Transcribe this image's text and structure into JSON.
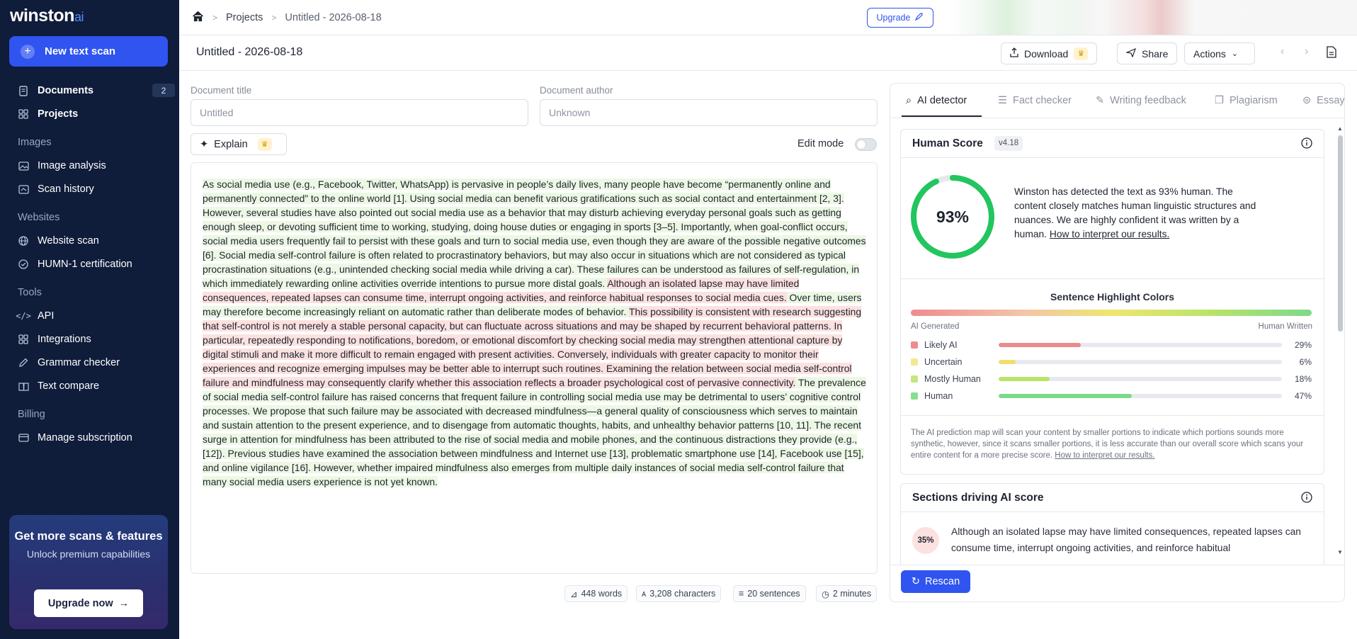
{
  "app": {
    "logo_main": "winston",
    "logo_suffix": "ai"
  },
  "sidebar": {
    "new_scan": "New text scan",
    "documents": {
      "label": "Documents",
      "count": "2"
    },
    "projects": "Projects",
    "images_title": "Images",
    "image_analysis": "Image analysis",
    "scan_history": "Scan history",
    "websites_title": "Websites",
    "website_scan": "Website scan",
    "humn_cert": "HUMN-1 certification",
    "tools_title": "Tools",
    "api": "API",
    "integrations": "Integrations",
    "grammar_checker": "Grammar checker",
    "text_compare": "Text compare",
    "billing_title": "Billing",
    "manage_subscription": "Manage subscription",
    "promo": {
      "title": "Get more scans & features",
      "subtitle": "Unlock premium capabilities",
      "button": "Upgrade now"
    }
  },
  "topbar": {
    "breadcrumb_projects": "Projects",
    "breadcrumb_current": "Untitled - 2026-08-18",
    "upgrade": "Upgrade"
  },
  "toolbar": {
    "doc_title": "Untitled - 2026-08-18",
    "download": "Download",
    "share": "Share",
    "actions": "Actions"
  },
  "form": {
    "title_label": "Document title",
    "title_placeholder": "Untitled",
    "author_label": "Document author",
    "author_placeholder": "Unknown",
    "explain": "Explain",
    "edit_mode": "Edit mode"
  },
  "document": {
    "segments": [
      {
        "type": "human",
        "text": "As social media use (e.g., Facebook, Twitter, WhatsApp) is pervasive in people’s daily lives, many people have become “permanently online and permanently connected” to the online world [1]. Using social media can benefit various gratifications such as social contact and entertainment [2, 3]. However, several studies have also pointed out social media use as a behavior that may disturb achieving everyday personal goals such as getting enough sleep, or devoting sufficient time to working, studying, doing house duties or engaging in sports [3–5]. Importantly, when goal-conflict occurs, social media users frequently fail to persist with these goals and turn to social media use, even though they are aware of the possible negative outcomes [6]. Social media self-control failure is often related to procrastinatory behaviors, but may also occur in situations which are not considered as typical procrastination situations (e.g., unintended checking social media while driving a car). These failures can be understood as failures of self-regulation, in which immediately rewarding online activities override intentions to pursue more distal goals. "
      },
      {
        "type": "ai",
        "text": "Although an isolated lapse may have limited consequences, repeated lapses can consume time, interrupt ongoing activities, and reinforce habitual responses to social media cues."
      },
      {
        "type": "human",
        "text": " Over time, users may therefore become increasingly reliant on automatic rather than deliberate modes of behavior. "
      },
      {
        "type": "ai",
        "text": "This possibility is consistent with research suggesting that self-control is not merely a stable personal capacity, but can fluctuate across situations and may be shaped by recurrent behavioral patterns. In particular, repeatedly responding to notifications, boredom, or emotional discomfort by checking social media may strengthen attentional capture by digital stimuli and make it more difficult to remain engaged with present activities. Conversely, individuals with greater capacity to monitor their experiences and recognize emerging impulses may be better able to interrupt such routines. Examining the relation between social media self-control failure and mindfulness may consequently clarify whether this association reflects a broader psychological cost of pervasive connectivity."
      },
      {
        "type": "human",
        "text": " The prevalence of social media self-control failure has raised concerns that frequent failure in controlling social media use may be detrimental to users’ cognitive control processes. We propose that such failure may be associated with decreased mindfulness—a general quality of consciousness which serves to maintain and sustain attention to the present experience, and to disengage from automatic thoughts, habits, and unhealthy behavior patterns [10, 11]. The recent surge in attention for mindfulness has been attributed to the rise of social media and mobile phones, and the continuous distractions they provide (e.g., [12]). Previous studies have examined the association between mindfulness and Internet use [13], problematic smartphone use [14], Facebook use [15], and online vigilance [16]. However, whether impaired mindfulness also emerges from multiple daily instances of social media self-control failure that many social media users experience is not yet known."
      }
    ]
  },
  "stats": {
    "words": "448 words",
    "characters": "3,208 characters",
    "sentences": "20 sentences",
    "minutes": "2 minutes"
  },
  "panel": {
    "tabs": [
      "AI detector",
      "Fact checker",
      "Writing feedback",
      "Plagiarism",
      "Essay"
    ],
    "human_score": {
      "title": "Human Score",
      "version": "v4.18",
      "percent": "93%",
      "percent_value": 0.93,
      "desc": "Winston has detected the text as 93% human. The content closely matches human linguistic structures and nuances. We are highly confident it was written by a human. ",
      "desc_link": "How to interpret our results."
    },
    "highlights": {
      "title": "Sentence Highlight Colors",
      "left_label": "AI Generated",
      "right_label": "Human Written",
      "rows": [
        {
          "label": "Likely AI",
          "pct": "29%",
          "value": 0.29,
          "color": "#ef8c8f",
          "fill": "#ea8a8e"
        },
        {
          "label": "Uncertain",
          "pct": "6%",
          "value": 0.06,
          "color": "#f3e88f",
          "fill": "#efe06a"
        },
        {
          "label": "Mostly Human",
          "pct": "18%",
          "value": 0.18,
          "color": "#c3e87d",
          "fill": "#b9e36a"
        },
        {
          "label": "Human",
          "pct": "47%",
          "value": 0.47,
          "color": "#86de8f",
          "fill": "#7dd98a"
        }
      ],
      "note": "The AI prediction map will scan your content by smaller portions to indicate which portions sounds more synthetic, however, since it scans smaller portions, it is less accurate than our overall score which scans your entire content for a more precise score. ",
      "note_link": "How to interpret our results."
    },
    "sections": {
      "title": "Sections driving AI score",
      "item_pct": "35%",
      "item_text": "Although an isolated lapse may have limited consequences, repeated lapses can consume time, interrupt ongoing activities, and reinforce habitual"
    },
    "rescan": "Rescan"
  },
  "colors": {
    "accent": "#2f54f0",
    "sidebar_bg": "#0f1c3a",
    "ring": "#22c55e",
    "human_hl": "#ecf8e4",
    "ai_hl": "#fbe1df"
  }
}
